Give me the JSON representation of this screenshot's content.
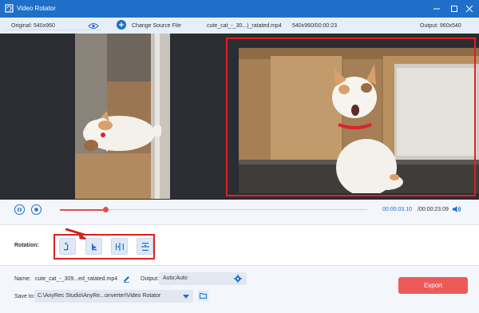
{
  "window": {
    "title": "Video Rotator",
    "accent": "#1f6fc9"
  },
  "infobar": {
    "original_label": "Original: 540x960",
    "change_source_label": "Change Source File",
    "file_name": "cute_cat_-_30...)_ratated.mp4",
    "file_meta": "540x960/00:00:23",
    "output_label": "Output: 960x540"
  },
  "playback": {
    "current_time": "00:00:03.10",
    "total_time": "/00:00:23.09",
    "progress_fraction": 0.15
  },
  "rotation": {
    "label": "Rotation:",
    "buttons": [
      "rotate-left",
      "rotate-right",
      "flip-horizontal",
      "flip-vertical"
    ]
  },
  "output_settings": {
    "name_label": "Name:",
    "name_value": "cute_cat_-_309...ed_ratated.mp4",
    "output_label": "Output:",
    "output_value": "Auto;Auto",
    "save_to_label": "Save to:",
    "save_to_value": "C:\\AnyRec Studio\\AnyRe...onverter\\Video Rotator",
    "export_label": "Export"
  },
  "colors": {
    "highlight": "#e02020",
    "export": "#ee5a5a",
    "preview_bg": "#2b2d33"
  }
}
